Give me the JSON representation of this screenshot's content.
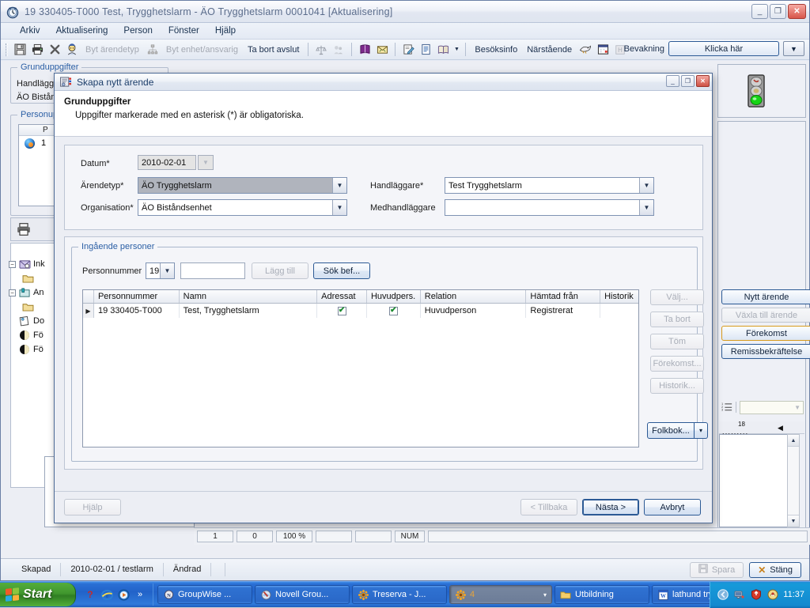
{
  "app": {
    "title": "19 330405-T000   Test, Trygghetslarm   -   ÄO Trygghetslarm   0001041   [Aktualisering]",
    "title_icon": "clock-icon",
    "window_buttons": {
      "minimize": "_",
      "maximize": "❐",
      "close": "✕"
    },
    "menu": [
      "Arkiv",
      "Aktualisering",
      "Person",
      "Fönster",
      "Hjälp"
    ],
    "toolbar": {
      "icons": [
        "save-icon",
        "print-icon",
        "delete-icon",
        "person-icon"
      ],
      "byt_arendetyp": "Byt ärendetyp",
      "byt_enhet": "Byt enhet/ansvarig",
      "ta_bort_avslut": "Ta bort avslut",
      "besoksinfo": "Besöksinfo",
      "narstaende": "Närstående"
    },
    "bevakning": {
      "label": "Bevakning",
      "button": "Klicka här",
      "dropdown_glyph": "▼"
    }
  },
  "background": {
    "group_grunduppgifter": "Grunduppgifter",
    "text_handlaggare": "Handläggare",
    "text_organisation": "ÄO Biståndsenhet",
    "group_personuppgifter": "Personuppgifter",
    "list_header": "P",
    "list_row": "1",
    "tree": [
      {
        "label": "Ink",
        "icon": "inbox-icon",
        "expander": "−",
        "indent": false
      },
      {
        "label": "",
        "icon": "folder-icon",
        "expander": "",
        "indent": true
      },
      {
        "label": "An",
        "icon": "anteckning-icon",
        "expander": "−",
        "indent": false
      },
      {
        "label": "",
        "icon": "folder-icon",
        "expander": "",
        "indent": true
      },
      {
        "label": "Do",
        "icon": "document-icon",
        "expander": "",
        "indent": false
      },
      {
        "label": "Fö",
        "icon": "circle-half-icon",
        "expander": "",
        "indent": false
      },
      {
        "label": "Fö",
        "icon": "circle-half-icon",
        "expander": "",
        "indent": false
      }
    ],
    "side_buttons": [
      {
        "label": "Nytt ärende",
        "state": "normal"
      },
      {
        "label": "Växla till ärende",
        "state": "disabled"
      },
      {
        "label": "Förekomst",
        "state": "highlighted"
      },
      {
        "label": "Remissbekräftelse",
        "state": "normal"
      }
    ],
    "traffic_light_icon": "traffic-light-icon",
    "ruler_mark": "18",
    "status_cells": [
      "1",
      "0",
      "100 %",
      "",
      "",
      "NUM",
      ""
    ]
  },
  "dialog": {
    "title": "Skapa nytt ärende",
    "title_icon": "new-case-icon",
    "window_buttons": {
      "minimize": "_",
      "maximize": "❐",
      "close": "✕"
    },
    "heading": "Grunduppgifter",
    "subheading": "Uppgifter markerade med en asterisk (*) är obligatoriska.",
    "fields": {
      "datum_label": "Datum*",
      "datum_value": "2010-02-01",
      "arendetyp_label": "Ärendetyp*",
      "arendetyp_value": "ÄO Trygghetslarm",
      "organisation_label": "Organisation*",
      "organisation_value": "ÄO Biståndsenhet",
      "handlaggare_label": "Handläggare*",
      "handlaggare_value": "Test Trygghetslarm",
      "medhandlaggare_label": "Medhandläggare",
      "medhandlaggare_value": ""
    },
    "persons_group": {
      "title": "Ingående personer",
      "personnummer_label": "Personnummer",
      "century_value": "19",
      "pnr_input_value": "",
      "pnr_input_placeholder": "",
      "lagg_till": "Lägg till",
      "sok_bef": "Sök bef..."
    },
    "grid": {
      "columns": [
        "Personnummer",
        "Namn",
        "Adressat",
        "Huvudpers.",
        "Relation",
        "Hämtad från",
        "Historik"
      ],
      "rows": [
        {
          "marker": "▶",
          "personnummer": "19 330405-T000",
          "namn": "Test, Trygghetslarm",
          "adressat": true,
          "huvudpers": true,
          "relation": "Huvudperson",
          "hamtad_fran": "Registrerat",
          "historik": ""
        }
      ],
      "checkmark": "✔"
    },
    "side_buttons": [
      {
        "label": "Välj...",
        "state": "disabled"
      },
      {
        "label": "Ta bort",
        "state": "disabled"
      },
      {
        "label": "Töm",
        "state": "disabled"
      },
      {
        "label": "Förekomst...",
        "state": "disabled"
      },
      {
        "label": "Historik...",
        "state": "disabled"
      }
    ],
    "folkbok": {
      "label": "Folkbok...",
      "dropdown_glyph": "▾"
    },
    "footer": {
      "hjalp": "Hjälp",
      "tillbaka": "< Tillbaka",
      "nasta": "Nästa >",
      "avbryt": "Avbryt"
    }
  },
  "app_bottom": {
    "skapad_label": "Skapad",
    "skapad_value": "2010-02-01 / testlarm",
    "andrad_label": "Ändrad",
    "spara": "Spara",
    "stang": "Stäng",
    "spara_icon": "floppy-icon",
    "stang_icon": "x-icon"
  },
  "taskbar": {
    "start": "Start",
    "quicklaunch": [
      "help-icon",
      "ie-icon",
      "media-icon",
      "chevron-more-icon"
    ],
    "tasks": [
      {
        "label": "GroupWise ...",
        "icon": "groupwise-icon",
        "active": false
      },
      {
        "label": "Novell Grou...",
        "icon": "novell-icon",
        "active": false
      },
      {
        "label": "Treserva - J...",
        "icon": "treserva-icon",
        "active": false
      },
      {
        "label": "4",
        "icon": "treserva-icon",
        "active": true
      },
      {
        "label": "Utbildning",
        "icon": "folder-icon",
        "active": false
      },
      {
        "label": "lathund tryg...",
        "icon": "word-icon",
        "active": false
      }
    ],
    "tray_icons": [
      "chevron-left-icon",
      "network-icon",
      "shield-icon",
      "update-icon"
    ],
    "clock": "11:37"
  },
  "colors": {
    "accent_blue": "#2c5a95",
    "group_label_blue": "#2b5fa5",
    "check_green": "#1a8a2e",
    "highlight_orange": "#d79a1b",
    "taskbar_blue": "#2263c9",
    "start_green": "#41972e",
    "selected_grey": "#b0b4bd"
  }
}
